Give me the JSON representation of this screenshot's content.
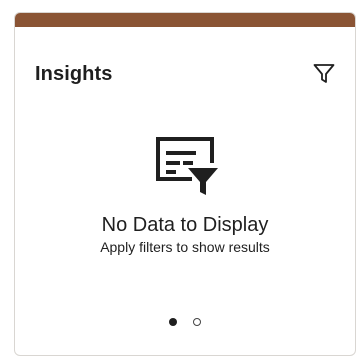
{
  "card": {
    "title": "Insights",
    "accent_color": "#8a5434",
    "filter_icon": "filter-funnel-outline-icon"
  },
  "empty_state": {
    "icon": "filtered-list-icon",
    "title": "No Data to Display",
    "subtitle": "Apply filters to show results"
  },
  "pager": {
    "page_count": 2,
    "active_page": 1
  }
}
